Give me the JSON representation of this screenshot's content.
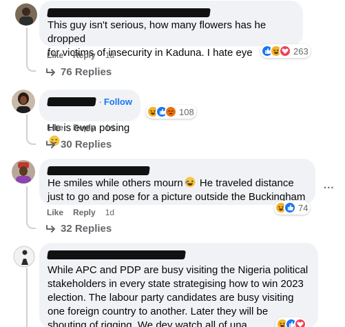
{
  "comments": [
    {
      "text": "This guy isn't serious, how many flowers has he dropped\nfor victims of insecurity in Kaduna. I hate eye",
      "like_label": "Like",
      "reply_label": "Reply",
      "age": "1d",
      "reaction_count": "263",
      "reactions": [
        "like-icon",
        "haha-icon",
        "love-icon"
      ],
      "replies_label": "76 Replies"
    },
    {
      "text": "He is even posing",
      "follow_label": "Follow",
      "follow_dot": "·",
      "like_label": "Like",
      "reply_label": "Reply",
      "age": "1d",
      "reaction_count": "108",
      "reactions": [
        "haha-icon",
        "like-icon",
        "angry-icon"
      ],
      "replies_label": "30 Replies"
    },
    {
      "text_part1": "He smiles while others mourn",
      "text_part2": " He traveled distance\njust to go and pose for a picture outside the Buckingham",
      "like_label": "Like",
      "reply_label": "Reply",
      "age": "1d",
      "reaction_count": "74",
      "reactions": [
        "haha-icon",
        "like-icon"
      ],
      "replies_label": "32 Replies",
      "more_label": "..."
    },
    {
      "text": "While APC and PDP are busy visiting the Nigeria political\nstakeholders in every state strategising how to win 2023\nelection. The labour party candidates are busy visiting\none foreign country to another. Later they will be\nshouting of rigging. We dey watch all of una.",
      "reactions": [
        "haha-icon",
        "like-icon",
        "love-icon"
      ]
    }
  ],
  "colors": {
    "bubble": "#f0f2f5",
    "meta_text": "#65676b",
    "accent_blue": "#1877f2",
    "thread_line": "#ced0d4"
  }
}
